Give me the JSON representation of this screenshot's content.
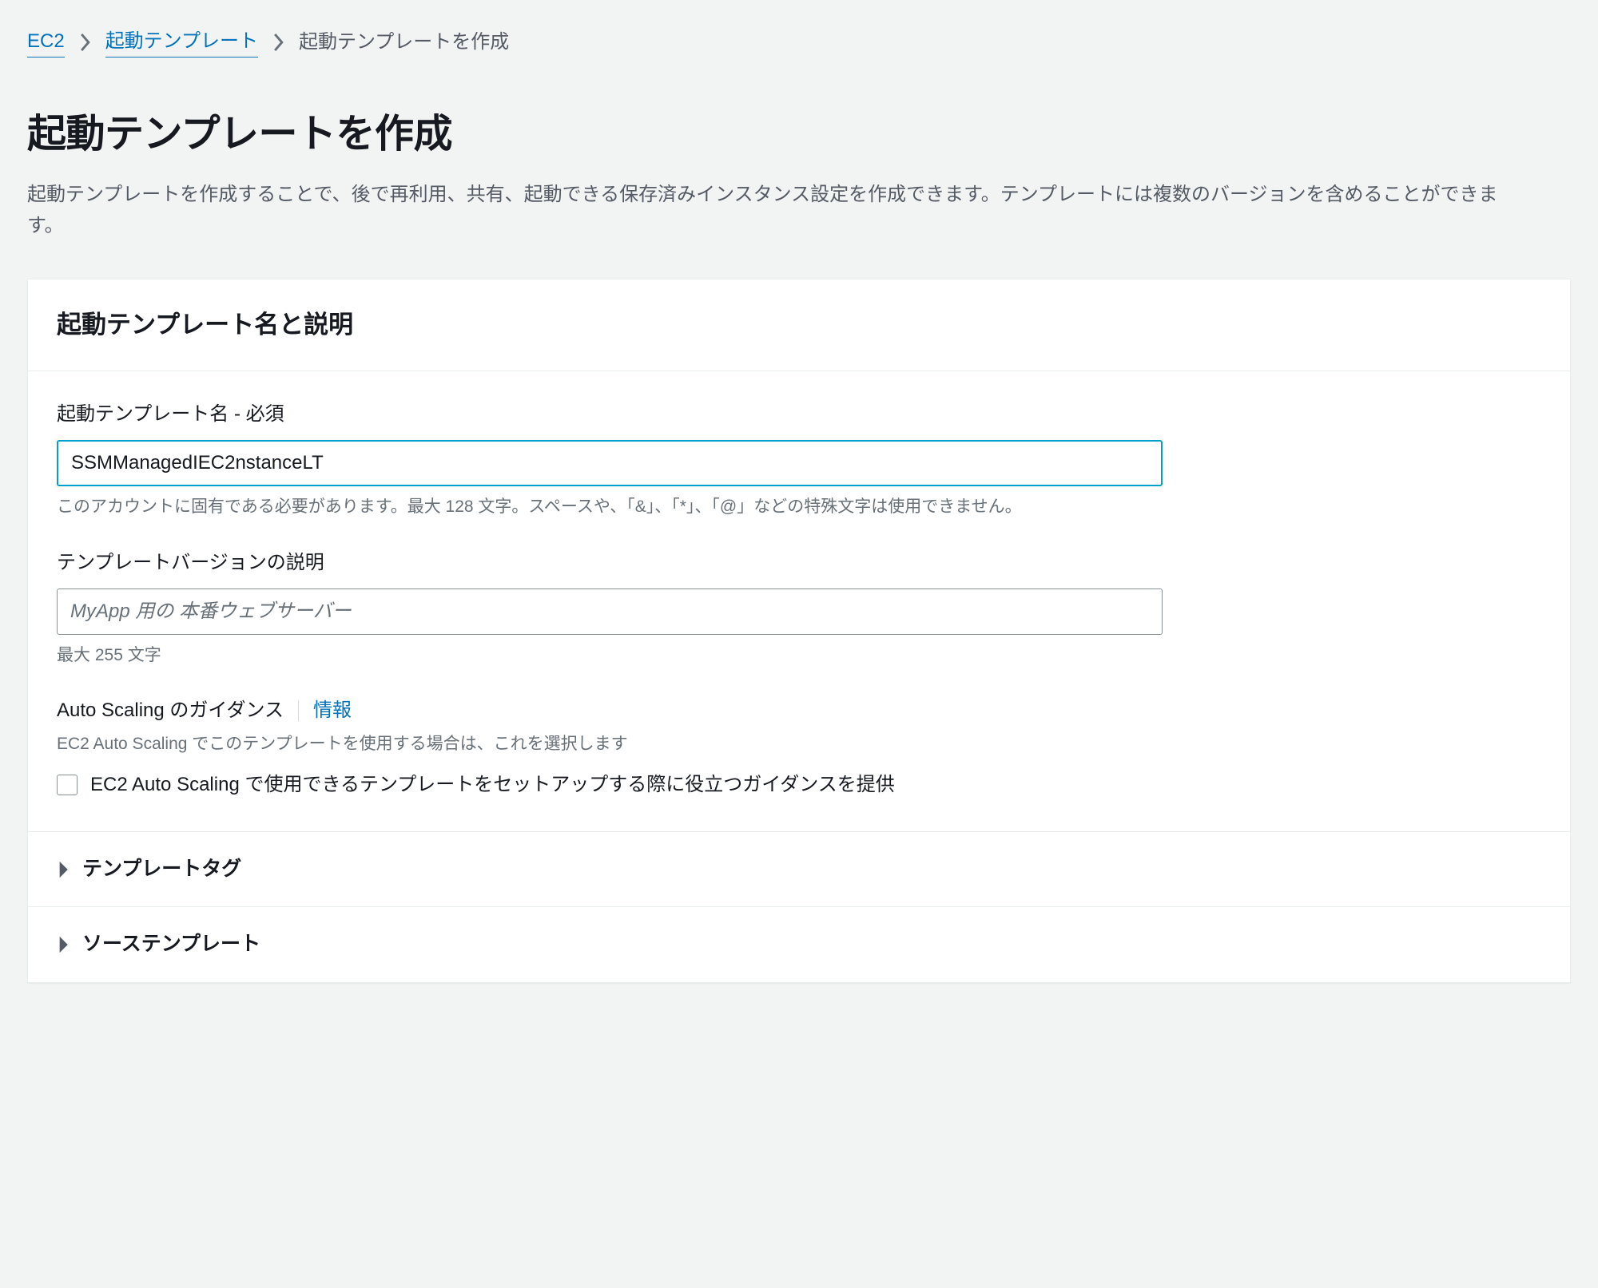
{
  "breadcrumb": {
    "root": "EC2",
    "parent": "起動テンプレート",
    "current": "起動テンプレートを作成"
  },
  "page": {
    "title": "起動テンプレートを作成",
    "description": "起動テンプレートを作成することで、後で再利用、共有、起動できる保存済みインスタンス設定を作成できます。テンプレートには複数のバージョンを含めることができます。"
  },
  "panel": {
    "heading": "起動テンプレート名と説明",
    "name_field": {
      "label": "起動テンプレート名 - 必須",
      "value": "SSMManagedIEC2nstanceLT",
      "hint": "このアカウントに固有である必要があります。最大 128 文字。スペースや、「&」、「*」、「@」などの特殊文字は使用できません。"
    },
    "desc_field": {
      "label": "テンプレートバージョンの説明",
      "placeholder": "MyApp 用の 本番ウェブサーバー",
      "value": "",
      "hint": "最大 255 文字"
    },
    "autoscaling": {
      "label": "Auto Scaling のガイダンス",
      "info": "情報",
      "desc": "EC2 Auto Scaling でこのテンプレートを使用する場合は、これを選択します",
      "checkbox_label": "EC2 Auto Scaling で使用できるテンプレートをセットアップする際に役立つガイダンスを提供"
    },
    "expanders": {
      "tags": "テンプレートタグ",
      "source": "ソーステンプレート"
    }
  }
}
